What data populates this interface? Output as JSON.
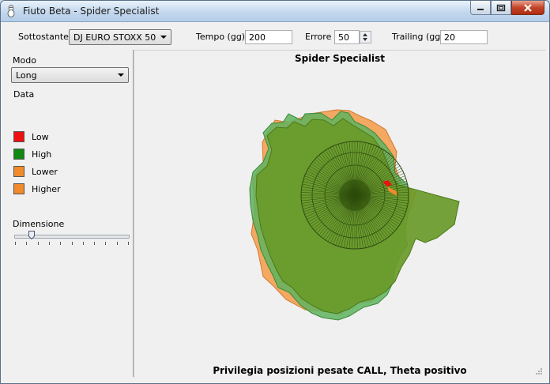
{
  "window": {
    "title": "Fiuto Beta - Spider Specialist"
  },
  "toolbar": {
    "sottostante_label": "Sottostante",
    "sottostante_value": "DJ EURO STOXX 50",
    "tempo_label": "Tempo (gg)",
    "tempo_value": "200",
    "errore_label": "Errore",
    "errore_value": "50",
    "trailing_label": "Trailing (gg)",
    "trailing_value": "20"
  },
  "sidebar": {
    "modo_label": "Modo",
    "modo_value": "Long",
    "data_label": "Data",
    "legend": [
      {
        "label": "Low",
        "color": "#ee1111"
      },
      {
        "label": "High",
        "color": "#118811"
      },
      {
        "label": "Lower",
        "color": "#f08a2a"
      },
      {
        "label": "Higher",
        "color": "#f08a2a"
      }
    ],
    "dimensione_label": "Dimensione",
    "slider_value_fraction": 0.15
  },
  "chart": {
    "title": "Spider Specialist",
    "footer": "Privilegia posizioni pesate CALL, Theta positivo"
  },
  "colors": {
    "green_fill": "#6a9a2a",
    "green_dark": "#3c7a20",
    "green_light": "#5fb35f",
    "orange_fill": "#f4a862"
  }
}
